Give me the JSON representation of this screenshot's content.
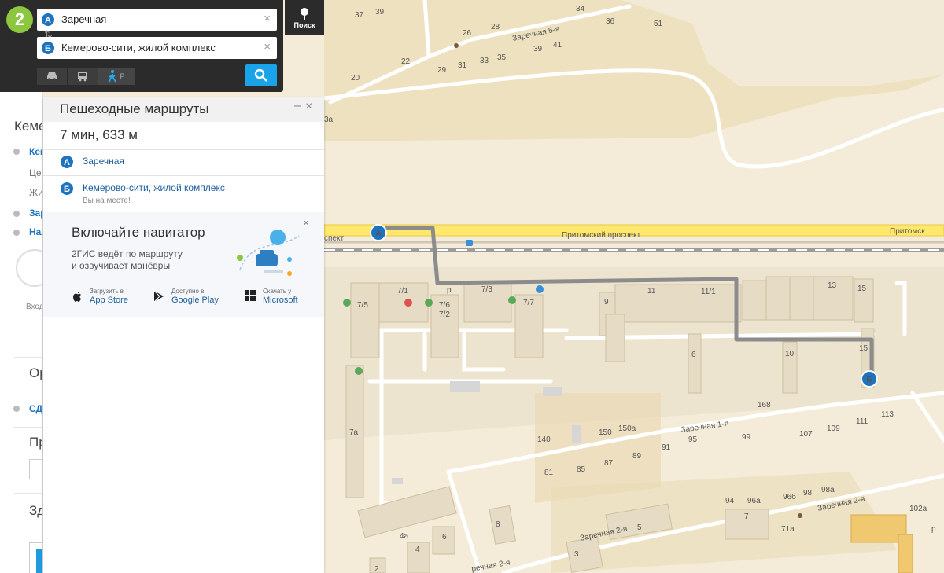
{
  "search": {
    "logo": "2",
    "from_badge": "А",
    "from_value": "Заречная",
    "to_badge": "Б",
    "to_value": "Кемерово-сити, жилой комплекс",
    "clear_icon": "×",
    "swap_icon": "⇅",
    "mode_walk_sup": "Р",
    "search_button_label": "Поиск"
  },
  "route_panel": {
    "title": "Пешеходные маршруты",
    "minimize_icon": "–",
    "close_icon": "×",
    "summary": "7 мин, 633 м",
    "point_a_badge": "А",
    "point_a": "Заречная",
    "point_b_badge": "Б",
    "point_b": "Кемерово-сити, жилой комплекс",
    "point_b_note": "Вы на месте!"
  },
  "promo": {
    "title": "Включайте навигатор",
    "text_line1": "2ГИС ведёт по маршруту",
    "text_line2": "и озвучивает манёвры",
    "close_icon": "×",
    "stores": [
      {
        "small": "Загрузить в",
        "name": "App Store",
        "icon": "apple-icon"
      },
      {
        "small": "Доступно в",
        "name": "Google Play",
        "icon": "google-play-icon"
      },
      {
        "small": "Скачать у",
        "name": "Microsoft",
        "icon": "windows-icon"
      }
    ]
  },
  "background_sidebar": {
    "city": "Кеме",
    "item1": "Кем",
    "item2": "Цен",
    "item3": "Жил",
    "item4": "Зар",
    "item5": "Нал",
    "entry": "Вход",
    "org": "Ор",
    "sd": "СД",
    "pr": "Пр",
    "zd": "Зд"
  },
  "map": {
    "street_pritomsky": "Притомский проспект",
    "street_pritomsk_cut": "Притомск",
    "street_prospekt_cut": "спект",
    "street_zarechnaya5": "Заречная 5-я",
    "street_zarechnaya1": "Заречная 1-я",
    "street_zarechnaya2a": "Заречная 2-я",
    "street_zarechnaya2b": "Заречная 2-я",
    "street_zarechnaya2c": "речная 2-я",
    "marker_a": "А",
    "marker_b": "Б",
    "house_numbers": [
      "37",
      "39",
      "34",
      "36",
      "51",
      "26",
      "28",
      "22",
      "29",
      "31",
      "33",
      "35",
      "39",
      "41",
      "20",
      "3а",
      "7/1",
      "7/3",
      "7/5",
      "7/6",
      "7/2",
      "7/7",
      "9",
      "11",
      "11/1",
      "13",
      "15",
      "15",
      "6",
      "10",
      "168",
      "7а",
      "140",
      "150",
      "150а",
      "99",
      "107",
      "109",
      "111",
      "113",
      "95",
      "91",
      "89",
      "87",
      "85",
      "81",
      "94",
      "96а",
      "96б",
      "98",
      "98а",
      "102а",
      "8",
      "7",
      "71а",
      "5",
      "4а",
      "4",
      "6",
      "3",
      "2",
      "р",
      "р"
    ],
    "colors": {
      "background": "#f4ecd8",
      "road_main": "#ffe86b",
      "route": "#8c8c8c",
      "building": "#e6dcc6",
      "block": "#eee5cf",
      "accent": "#1e73be"
    }
  }
}
